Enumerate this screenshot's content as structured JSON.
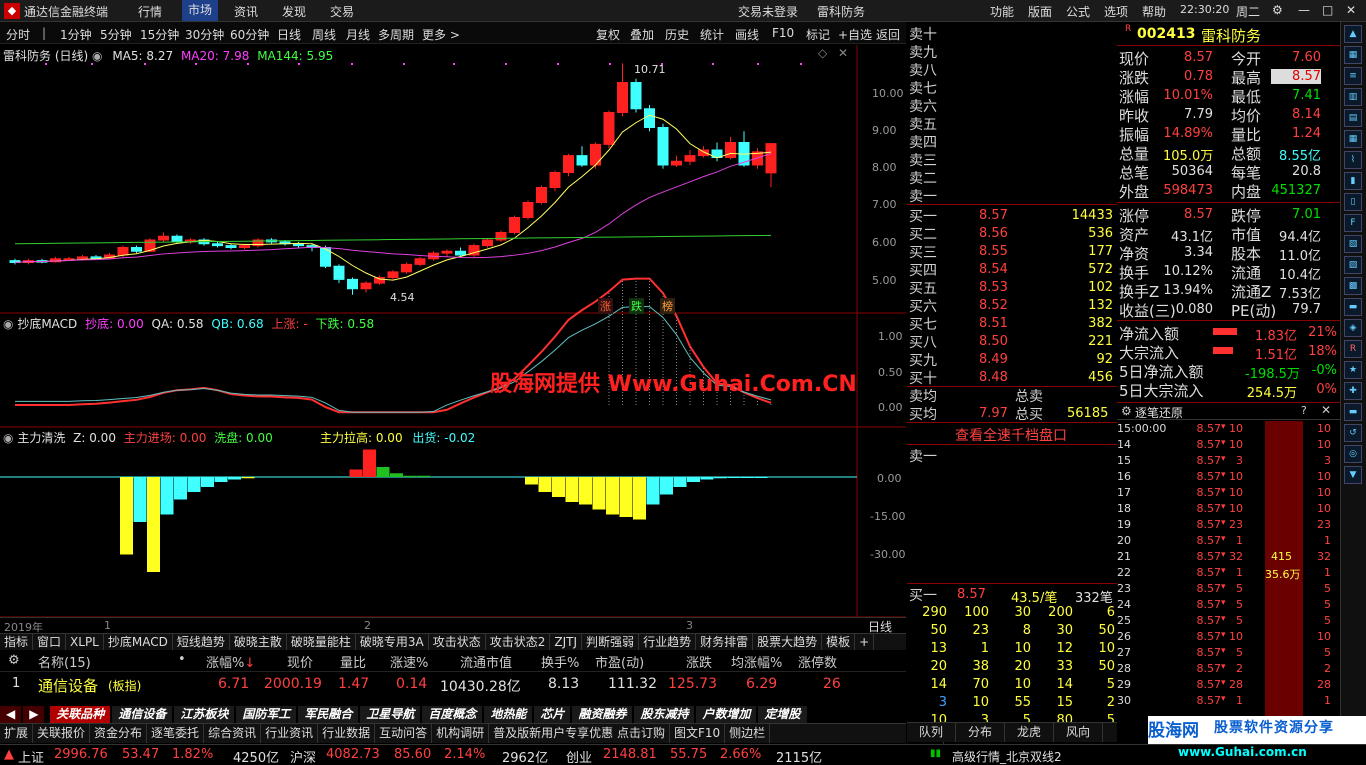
{
  "titlebar": {
    "app_title": "通达信金融终端",
    "menu": [
      "行情",
      "市场",
      "资讯",
      "发现",
      "交易"
    ],
    "trade_status": "交易未登录",
    "stock_tag": "雷科防务",
    "right_menu": [
      "功能",
      "版面",
      "公式",
      "选项",
      "帮助"
    ],
    "time": "22:30:20",
    "weekday": "周二"
  },
  "toolbar": {
    "periods": [
      "分时",
      "1分钟",
      "5分钟",
      "15分钟",
      "30分钟",
      "60分钟",
      "日线",
      "周线",
      "月线",
      "多周期",
      "更多 >"
    ],
    "actions": [
      "复权",
      "叠加",
      "历史",
      "统计",
      "画线",
      "F10",
      "标记",
      "+自选",
      "返回"
    ]
  },
  "main_chart": {
    "title": "雷科防务 (日线)",
    "ma5": "MA5: 8.27",
    "ma20": "MA20: 7.98",
    "ma144": "MA144: 5.95",
    "high_label": "10.71",
    "low_label": "4.54",
    "zdb": [
      "涨",
      "跌",
      "榜"
    ],
    "yticks": [
      "10.00",
      "9.00",
      "8.00",
      "7.00",
      "6.00",
      "5.00"
    ]
  },
  "macd": {
    "title": "抄底MACD",
    "cd": "抄底: 0.00",
    "qa": "QA: 0.58",
    "qb": "QB: 0.68",
    "up": "上涨: -",
    "down": "下跌: 0.58",
    "yticks": [
      "1.00",
      "0.50",
      "0.00"
    ]
  },
  "watermark": "股海网提供 Www.Guhai.Com.CN",
  "zl": {
    "title": "主力清洗",
    "z": "Z: 0.00",
    "zljc": "主力进场: 0.00",
    "xp": "洗盘: 0.00",
    "zllg": "主力拉高: 0.00",
    "ch": "出货: -0.02",
    "yticks": [
      "0.00",
      "-15.00",
      "-30.00"
    ]
  },
  "time_axis": {
    "year": "2019年",
    "m1": "1",
    "m2": "2",
    "m3": "3",
    "period": "日线"
  },
  "indicator_tabs": [
    "指标",
    "窗口",
    "XLPL",
    "抄底MACD",
    "短线趋势",
    "破晓主散",
    "破晓量能柱",
    "破晓专用3A",
    "攻击状态",
    "攻击状态2",
    "ZJTJ",
    "判断强弱",
    "行业趋势",
    "财务排雷",
    "股票大趋势",
    "模板",
    "+"
  ],
  "table": {
    "headers": [
      "名称(15)",
      "•",
      "涨幅%",
      "现价",
      "量比",
      "涨速%",
      "流通市值",
      "换手%",
      "市盈(动)",
      "涨跌",
      "均涨幅%",
      "涨停数"
    ],
    "rows": [
      [
        "1",
        "通信设备",
        "(板指)",
        "6.71",
        "2000.19",
        "1.47",
        "0.14",
        "10430.28亿",
        "8.13",
        "111.32",
        "125.73",
        "6.29",
        "26"
      ]
    ]
  },
  "block_tabs": [
    "关联品种",
    "通信设备",
    "江苏板块",
    "国防军工",
    "军民融合",
    "卫星导航",
    "百度概念",
    "地热能",
    "芯片",
    "融资融券",
    "股东减持",
    "户数增加",
    "定增股"
  ],
  "bottom_tabs": [
    "扩展",
    "关联报价",
    "资金分布",
    "逐笔委托",
    "综合资讯",
    "行业资讯",
    "行业数据",
    "互动问答",
    "机构调研",
    "普及版新用户专享优惠 点击订购",
    "图文F10",
    "侧边栏"
  ],
  "right_tabs": [
    "队列",
    "分布",
    "龙虎",
    "风向",
    "笔"
  ],
  "orderbook": {
    "sells": [
      "卖十",
      "卖九",
      "卖八",
      "卖七",
      "卖六",
      "卖五",
      "卖四",
      "卖三",
      "卖二",
      "卖一"
    ],
    "buys": [
      [
        "买一",
        "8.57",
        "14433"
      ],
      [
        "买二",
        "8.56",
        "536"
      ],
      [
        "买三",
        "8.55",
        "177"
      ],
      [
        "买四",
        "8.54",
        "572"
      ],
      [
        "买五",
        "8.53",
        "102"
      ],
      [
        "买六",
        "8.52",
        "132"
      ],
      [
        "买七",
        "8.51",
        "382"
      ],
      [
        "买八",
        "8.50",
        "221"
      ],
      [
        "买九",
        "8.49",
        "92"
      ],
      [
        "买十",
        "8.48",
        "456"
      ]
    ],
    "avg_sell_label": "卖均",
    "total_sell_label": "总卖",
    "avg_buy_label": "买均",
    "avg_buy": "7.97",
    "total_buy_label": "总买",
    "total_buy": "56185",
    "link": "查看全速千档盘口",
    "queue_label": "卖一",
    "buy1": [
      "买一",
      "8.57",
      "43.5/笔",
      "332笔"
    ],
    "queue": [
      [
        "290",
        "100",
        "30",
        "200",
        "6"
      ],
      [
        "50",
        "23",
        "8",
        "30",
        "50"
      ],
      [
        "13",
        "1",
        "10",
        "12",
        "10"
      ],
      [
        "20",
        "38",
        "20",
        "33",
        "50"
      ],
      [
        "14",
        "70",
        "10",
        "14",
        "5"
      ],
      [
        "3",
        "10",
        "55",
        "15",
        "2"
      ],
      [
        "10",
        "3",
        "5",
        "80",
        "5"
      ]
    ]
  },
  "info": {
    "code": "002413",
    "name": "雷科防务",
    "rows": [
      [
        "现价",
        "8.57",
        "今开",
        "7.60"
      ],
      [
        "涨跌",
        "0.78",
        "最高",
        "8.57"
      ],
      [
        "涨幅",
        "10.01%",
        "最低",
        "7.41"
      ],
      [
        "昨收",
        "7.79",
        "均价",
        "8.14"
      ],
      [
        "振幅",
        "14.89%",
        "量比",
        "1.24"
      ],
      [
        "总量",
        "105.0万",
        "总额",
        "8.55亿"
      ],
      [
        "总笔",
        "50364",
        "每笔",
        "20.8"
      ],
      [
        "外盘",
        "598473",
        "内盘",
        "451327"
      ]
    ],
    "rows2": [
      [
        "涨停",
        "8.57",
        "跌停",
        "7.01"
      ],
      [
        "资产",
        "43.1亿",
        "市值",
        "94.4亿"
      ],
      [
        "净资",
        "3.34",
        "股本",
        "11.0亿"
      ],
      [
        "换手",
        "10.12%",
        "流通",
        "10.4亿"
      ],
      [
        "换手Z",
        "13.94%",
        "流通Z",
        "7.53亿"
      ],
      [
        "收益(三)",
        "0.080",
        "PE(动)",
        "79.7"
      ]
    ],
    "flows": [
      [
        "净流入额",
        "1.83亿",
        "21%"
      ],
      [
        "大宗流入",
        "1.51亿",
        "18%"
      ],
      [
        "5日净流入额",
        "-198.5万",
        "-0%"
      ],
      [
        "5日大宗流入",
        "254.5万",
        "0%"
      ]
    ],
    "ticks_title": "逐笔还原",
    "ticks": [
      [
        "15:00:00",
        "8.57",
        "10",
        "10"
      ],
      [
        "14",
        "8.57",
        "10",
        "10"
      ],
      [
        "15",
        "8.57",
        "3",
        "3"
      ],
      [
        "16",
        "8.57",
        "10",
        "10"
      ],
      [
        "17",
        "8.57",
        "10",
        "10"
      ],
      [
        "18",
        "8.57",
        "10",
        "10"
      ],
      [
        "19",
        "8.57",
        "23",
        "23"
      ],
      [
        "20",
        "8.57",
        "1",
        "1"
      ],
      [
        "21",
        "8.57",
        "32",
        "32"
      ],
      [
        "22",
        "8.57",
        "1",
        "1"
      ],
      [
        "23",
        "8.57",
        "5",
        "5"
      ],
      [
        "24",
        "8.57",
        "5",
        "5"
      ],
      [
        "25",
        "8.57",
        "5",
        "5"
      ],
      [
        "26",
        "8.57",
        "10",
        "10"
      ],
      [
        "27",
        "8.57",
        "5",
        "5"
      ],
      [
        "28",
        "8.57",
        "2",
        "2"
      ],
      [
        "29",
        "8.57",
        "28",
        "28"
      ],
      [
        "30",
        "8.57",
        "1",
        "1"
      ]
    ],
    "bar_label1": "415",
    "bar_label2": "35.6万"
  },
  "statusbar": {
    "sh_label": "上证",
    "sh": "2996.76",
    "sh_chg": "53.47",
    "sh_pct": "1.82%",
    "sh_amt": "4250亿",
    "hs_label": "沪深",
    "hs": "4082.73",
    "hs_chg": "85.60",
    "hs_pct": "2.14%",
    "hs_amt": "2962亿",
    "cy_label": "创业",
    "cy": "2148.81",
    "cy_chg": "55.75",
    "cy_pct": "2.66%",
    "cy_amt": "2115亿",
    "right": "高级行情_北京双线2"
  },
  "brand": {
    "name": "股海网",
    "slogan": "股票软件资源分享",
    "url": "www.Guhai.com.cn"
  },
  "chart_data": {
    "type": "candlestick",
    "title": "雷科防务 (日线)",
    "candles": [
      [
        5.45,
        5.4,
        5.5,
        5.35
      ],
      [
        5.4,
        5.45,
        5.5,
        5.35
      ],
      [
        5.45,
        5.42,
        5.5,
        5.38
      ],
      [
        5.42,
        5.5,
        5.55,
        5.4
      ],
      [
        5.5,
        5.5,
        5.55,
        5.45
      ],
      [
        5.5,
        5.55,
        5.6,
        5.45
      ],
      [
        5.55,
        5.52,
        5.6,
        5.48
      ],
      [
        5.52,
        5.6,
        5.65,
        5.5
      ],
      [
        5.6,
        5.8,
        5.85,
        5.55
      ],
      [
        5.8,
        5.7,
        5.85,
        5.65
      ],
      [
        5.7,
        6.0,
        6.05,
        5.68
      ],
      [
        6.0,
        6.1,
        6.2,
        5.95
      ],
      [
        6.1,
        5.95,
        6.15,
        5.9
      ],
      [
        5.95,
        6.0,
        6.05,
        5.9
      ],
      [
        6.0,
        5.9,
        6.05,
        5.85
      ],
      [
        5.9,
        5.85,
        5.95,
        5.8
      ],
      [
        5.85,
        5.8,
        5.9,
        5.75
      ],
      [
        5.8,
        5.85,
        5.9,
        5.75
      ],
      [
        5.85,
        6.0,
        6.05,
        5.8
      ],
      [
        6.0,
        5.95,
        6.05,
        5.9
      ],
      [
        5.95,
        5.9,
        6.0,
        5.85
      ],
      [
        5.9,
        5.85,
        5.95,
        5.8
      ],
      [
        5.85,
        5.8,
        5.9,
        5.7
      ],
      [
        5.8,
        5.3,
        5.85,
        5.25
      ],
      [
        5.3,
        4.95,
        5.35,
        4.85
      ],
      [
        4.95,
        4.7,
        5.0,
        4.54
      ],
      [
        4.7,
        4.85,
        4.9,
        4.6
      ],
      [
        4.85,
        5.0,
        5.05,
        4.8
      ],
      [
        5.0,
        5.15,
        5.2,
        4.95
      ],
      [
        5.15,
        5.35,
        5.4,
        5.1
      ],
      [
        5.35,
        5.5,
        5.55,
        5.3
      ],
      [
        5.5,
        5.65,
        5.7,
        5.45
      ],
      [
        5.65,
        5.7,
        5.75,
        5.55
      ],
      [
        5.7,
        5.6,
        5.8,
        5.55
      ],
      [
        5.6,
        5.85,
        5.9,
        5.55
      ],
      [
        5.85,
        6.0,
        6.05,
        5.8
      ],
      [
        6.0,
        6.2,
        6.25,
        5.95
      ],
      [
        6.2,
        6.6,
        6.65,
        6.15
      ],
      [
        6.6,
        7.0,
        7.05,
        6.55
      ],
      [
        7.0,
        7.4,
        7.45,
        6.95
      ],
      [
        7.4,
        7.8,
        7.85,
        7.3
      ],
      [
        7.8,
        8.25,
        8.3,
        7.7
      ],
      [
        8.25,
        8.0,
        8.5,
        7.95
      ],
      [
        8.0,
        8.55,
        8.6,
        7.9
      ],
      [
        8.55,
        9.4,
        9.45,
        8.45
      ],
      [
        9.4,
        10.2,
        10.71,
        9.3
      ],
      [
        10.2,
        9.5,
        10.3,
        9.4
      ],
      [
        9.5,
        9.0,
        9.6,
        8.9
      ],
      [
        9.0,
        8.0,
        9.1,
        7.9
      ],
      [
        8.0,
        8.1,
        8.25,
        7.95
      ],
      [
        8.1,
        8.25,
        8.4,
        8.0
      ],
      [
        8.25,
        8.4,
        8.5,
        8.2
      ],
      [
        8.4,
        8.2,
        8.6,
        8.1
      ],
      [
        8.2,
        8.6,
        8.75,
        8.15
      ],
      [
        8.6,
        8.0,
        8.9,
        7.95
      ],
      [
        8.0,
        8.35,
        8.45,
        7.9
      ],
      [
        7.79,
        8.57,
        8.57,
        7.41
      ]
    ]
  }
}
